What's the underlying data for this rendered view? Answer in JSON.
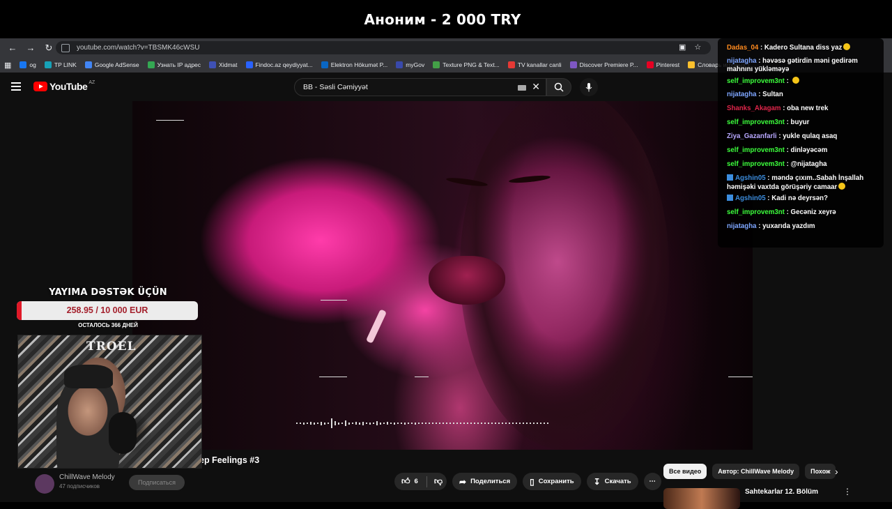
{
  "banner": {
    "text": "Аноним - 2 000 TRY"
  },
  "browser": {
    "url": "youtube.com/watch?v=TBSMK46cWSU",
    "bookmarks": [
      {
        "label": "og",
        "color": "#1877f2"
      },
      {
        "label": "TP LINK",
        "color": "#17a2b8"
      },
      {
        "label": "Google AdSense",
        "color": "#4285f4"
      },
      {
        "label": "Узнать IP адрес",
        "color": "#34a853"
      },
      {
        "label": "Xidmat",
        "color": "#3f51b5"
      },
      {
        "label": "Findoc.az qeydiyyat...",
        "color": "#2962ff"
      },
      {
        "label": "Elektron Hökumət P...",
        "color": "#0a66c2"
      },
      {
        "label": "myGov",
        "color": "#3949ab"
      },
      {
        "label": "Texture PNG & Text...",
        "color": "#43a047"
      },
      {
        "label": "TV kanallar canli",
        "color": "#e53935"
      },
      {
        "label": "Discover Premiere P...",
        "color": "#7e57c2"
      },
      {
        "label": "Pinterest",
        "color": "#e60023"
      },
      {
        "label": "Словарь игровых т...",
        "color": "#fbc02d"
      }
    ]
  },
  "youtube": {
    "logo": "YouTube",
    "region": "AZ",
    "search_value": "BB - Səsli Cəmiyyət",
    "video_title_partial": "ep Feelings #3",
    "channel_name": "ChillWave Melody",
    "subscribers": "47 подписчиков",
    "subscribe_label": "Подписаться",
    "likes": "6",
    "share_label": "Поделиться",
    "save_label": "Сохранить",
    "download_label": "Скачать",
    "chips": [
      "Все видео",
      "Автор: ChillWave Melody",
      "Похож"
    ],
    "rec_title": "Sahtekarlar 12. Bölüm"
  },
  "chat": [
    {
      "user": "Dadas_04",
      "color": "#ff8a1e",
      "text": "Kadero Sultana diss yaz",
      "emoji": true,
      "badge": false
    },
    {
      "user": "nijatagha",
      "color": "#7ea6ff",
      "text": "həvəsə gətirdin məni gedirəm mahnını yükləməyə",
      "emoji": false,
      "badge": false
    },
    {
      "user": "self_improvem3nt",
      "color": "#3dff3d",
      "text": "",
      "emoji": true,
      "badge": false
    },
    {
      "user": "nijatagha",
      "color": "#7ea6ff",
      "text": "Sultan",
      "emoji": false,
      "badge": false
    },
    {
      "user": "Shanks_Akagam",
      "color": "#e0254a",
      "text": "oba new trek",
      "emoji": false,
      "badge": false
    },
    {
      "user": "self_improvem3nt",
      "color": "#3dff3d",
      "text": "buyur",
      "emoji": false,
      "badge": false
    },
    {
      "user": "Ziya_Gazanfarli",
      "color": "#b8a8ff",
      "text": "yukle qulaq asaq",
      "emoji": false,
      "badge": false
    },
    {
      "user": "self_improvem3nt",
      "color": "#3dff3d",
      "text": "dinləyəcəm",
      "emoji": false,
      "badge": false
    },
    {
      "user": "self_improvem3nt",
      "color": "#3dff3d",
      "text": "@nijatagha",
      "emoji": false,
      "badge": false
    },
    {
      "user": "Agshin05",
      "color": "#3c8dde",
      "text": "məndə çıxım..Sabah İnşallah həmişəki vaxtda görüşəriy camaar",
      "emoji": true,
      "badge": true
    },
    {
      "user": "Agshin05",
      "color": "#3c8dde",
      "text": "Kadi nə deyrsən?",
      "emoji": false,
      "badge": true
    },
    {
      "user": "self_improvem3nt",
      "color": "#3dff3d",
      "text": "Gecəniz xeyrə",
      "emoji": false,
      "badge": false
    },
    {
      "user": "nijatagha",
      "color": "#7ea6ff",
      "text": "yuxarıda yazdım",
      "emoji": false,
      "badge": false
    }
  ],
  "donation": {
    "heading": "YAYIMA DƏSTƏK ÜÇÜN",
    "amount": "258.95 / 10 000 EUR",
    "progress": 0.026,
    "remaining": "ОСТАЛОСЬ 366 ДНЕЙ"
  },
  "webcam": {
    "sticker_text": "TROEL"
  }
}
